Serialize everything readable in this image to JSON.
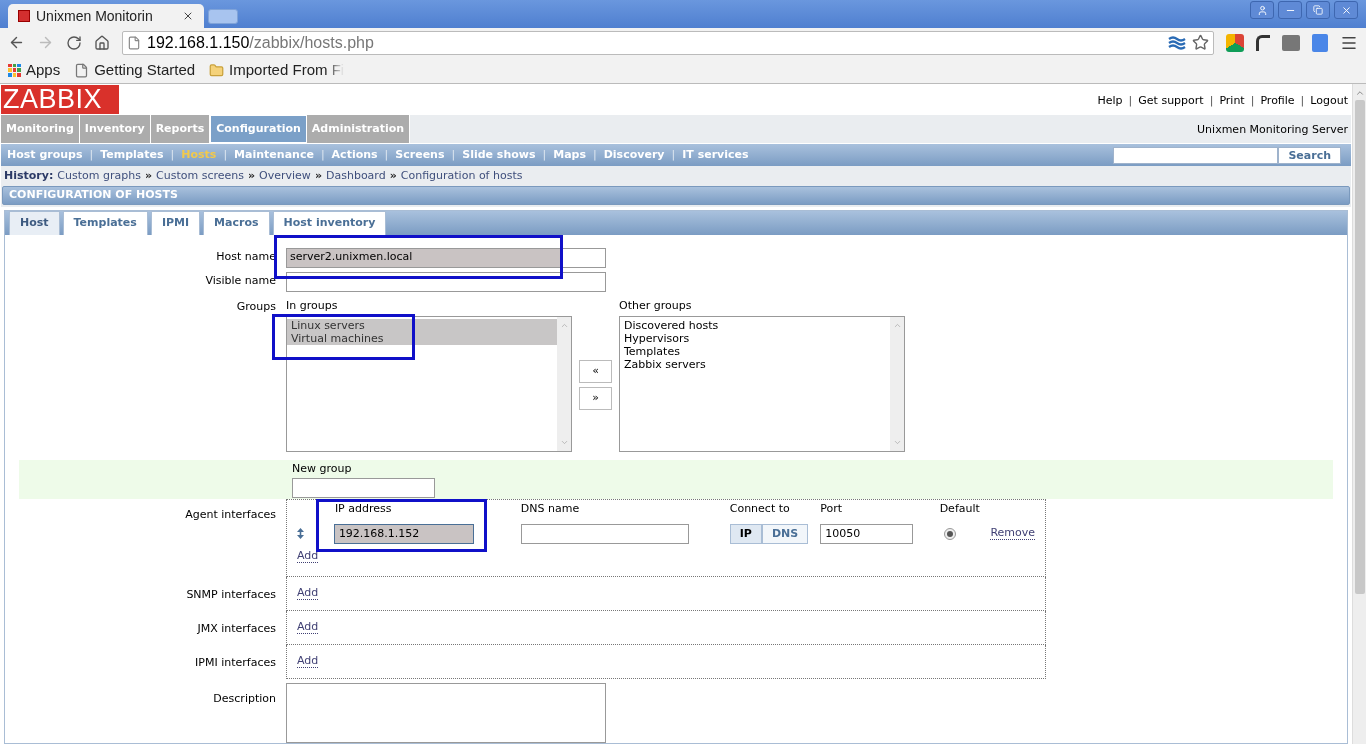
{
  "browser": {
    "tab_title": "Unixmen Monitorin",
    "url_host": "192.168.1.150",
    "url_path": "/zabbix/hosts.php",
    "bookmarks": [
      {
        "kind": "apps",
        "label": "Apps"
      },
      {
        "kind": "page",
        "label": "Getting Started"
      },
      {
        "kind": "folder",
        "label": "Imported From Fi"
      }
    ]
  },
  "header_links": [
    "Help",
    "Get support",
    "Print",
    "Profile",
    "Logout"
  ],
  "link_separator": "|",
  "logo": "ZABBIX",
  "main_menu": [
    {
      "label": "Monitoring",
      "selected": false
    },
    {
      "label": "Inventory",
      "selected": false
    },
    {
      "label": "Reports",
      "selected": false
    },
    {
      "label": "Configuration",
      "selected": true
    },
    {
      "label": "Administration",
      "selected": false
    }
  ],
  "server_name": "Unixmen Monitoring Server",
  "sub_menu": [
    {
      "label": "Host groups",
      "selected": false
    },
    {
      "label": "Templates",
      "selected": false
    },
    {
      "label": "Hosts",
      "selected": true
    },
    {
      "label": "Maintenance",
      "selected": false
    },
    {
      "label": "Actions",
      "selected": false
    },
    {
      "label": "Screens",
      "selected": false
    },
    {
      "label": "Slide shows",
      "selected": false
    },
    {
      "label": "Maps",
      "selected": false
    },
    {
      "label": "Discovery",
      "selected": false
    },
    {
      "label": "IT services",
      "selected": false
    }
  ],
  "search_button": "Search",
  "history": {
    "label": "History:",
    "items": [
      "Custom graphs",
      "Custom screens",
      "Overview",
      "Dashboard",
      "Configuration of hosts"
    ],
    "separator": "»"
  },
  "page_title": "CONFIGURATION OF HOSTS",
  "tabs": [
    {
      "label": "Host",
      "selected": true
    },
    {
      "label": "Templates",
      "selected": false
    },
    {
      "label": "IPMI",
      "selected": false
    },
    {
      "label": "Macros",
      "selected": false
    },
    {
      "label": "Host inventory",
      "selected": false
    }
  ],
  "form": {
    "host_name": {
      "label": "Host name",
      "value": "server2.unixmen.local"
    },
    "visible_name": {
      "label": "Visible name"
    },
    "groups": {
      "label": "Groups",
      "in_groups_label": "In groups",
      "in_groups": [
        {
          "label": "Linux servers",
          "selected": true
        },
        {
          "label": "Virtual machines",
          "selected": true
        }
      ],
      "move_left": "«",
      "move_right": "»",
      "other_groups_label": "Other groups",
      "other_groups": [
        {
          "label": "Discovered hosts",
          "selected": false
        },
        {
          "label": "Hypervisors",
          "selected": false
        },
        {
          "label": "Templates",
          "selected": false
        },
        {
          "label": "Zabbix servers",
          "selected": false
        }
      ]
    },
    "new_group": {
      "label": "New group"
    },
    "agent_interfaces": {
      "label": "Agent interfaces",
      "columns": [
        "IP address",
        "DNS name",
        "Connect to",
        "Port",
        "Default"
      ],
      "rows": [
        {
          "ip": "192.168.1.152",
          "dns": "",
          "connect_options": [
            {
              "label": "IP",
              "selected": true
            },
            {
              "label": "DNS",
              "selected": false
            }
          ],
          "port": "10050",
          "default": true,
          "remove": "Remove"
        }
      ],
      "add": "Add"
    },
    "other_interfaces": [
      {
        "label": "SNMP interfaces",
        "add": "Add"
      },
      {
        "label": "JMX interfaces",
        "add": "Add"
      },
      {
        "label": "IPMI interfaces",
        "add": "Add"
      }
    ],
    "description": {
      "label": "Description"
    }
  }
}
